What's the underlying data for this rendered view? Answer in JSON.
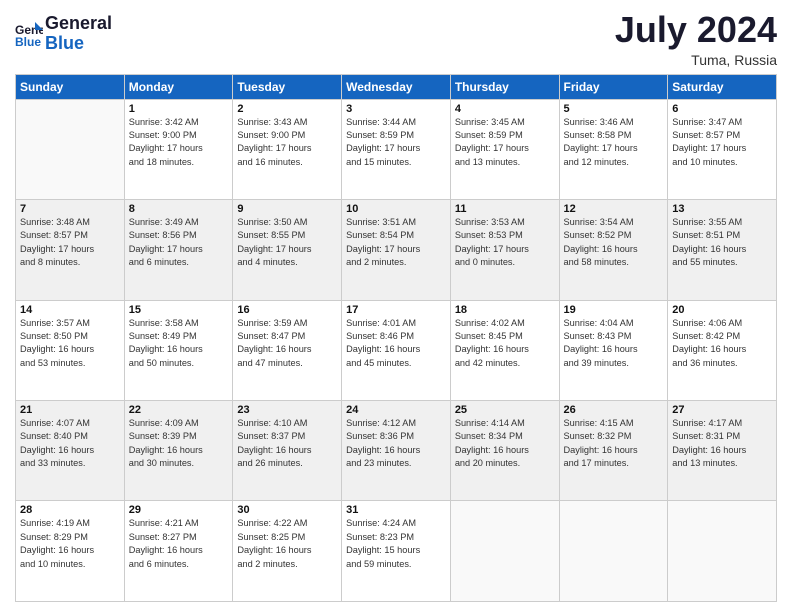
{
  "header": {
    "logo_line1": "General",
    "logo_line2": "Blue",
    "month_year": "July 2024",
    "location": "Tuma, Russia"
  },
  "days_of_week": [
    "Sunday",
    "Monday",
    "Tuesday",
    "Wednesday",
    "Thursday",
    "Friday",
    "Saturday"
  ],
  "weeks": [
    [
      {
        "day": "",
        "info": ""
      },
      {
        "day": "1",
        "info": "Sunrise: 3:42 AM\nSunset: 9:00 PM\nDaylight: 17 hours\nand 18 minutes."
      },
      {
        "day": "2",
        "info": "Sunrise: 3:43 AM\nSunset: 9:00 PM\nDaylight: 17 hours\nand 16 minutes."
      },
      {
        "day": "3",
        "info": "Sunrise: 3:44 AM\nSunset: 8:59 PM\nDaylight: 17 hours\nand 15 minutes."
      },
      {
        "day": "4",
        "info": "Sunrise: 3:45 AM\nSunset: 8:59 PM\nDaylight: 17 hours\nand 13 minutes."
      },
      {
        "day": "5",
        "info": "Sunrise: 3:46 AM\nSunset: 8:58 PM\nDaylight: 17 hours\nand 12 minutes."
      },
      {
        "day": "6",
        "info": "Sunrise: 3:47 AM\nSunset: 8:57 PM\nDaylight: 17 hours\nand 10 minutes."
      }
    ],
    [
      {
        "day": "7",
        "info": "Sunrise: 3:48 AM\nSunset: 8:57 PM\nDaylight: 17 hours\nand 8 minutes."
      },
      {
        "day": "8",
        "info": "Sunrise: 3:49 AM\nSunset: 8:56 PM\nDaylight: 17 hours\nand 6 minutes."
      },
      {
        "day": "9",
        "info": "Sunrise: 3:50 AM\nSunset: 8:55 PM\nDaylight: 17 hours\nand 4 minutes."
      },
      {
        "day": "10",
        "info": "Sunrise: 3:51 AM\nSunset: 8:54 PM\nDaylight: 17 hours\nand 2 minutes."
      },
      {
        "day": "11",
        "info": "Sunrise: 3:53 AM\nSunset: 8:53 PM\nDaylight: 17 hours\nand 0 minutes."
      },
      {
        "day": "12",
        "info": "Sunrise: 3:54 AM\nSunset: 8:52 PM\nDaylight: 16 hours\nand 58 minutes."
      },
      {
        "day": "13",
        "info": "Sunrise: 3:55 AM\nSunset: 8:51 PM\nDaylight: 16 hours\nand 55 minutes."
      }
    ],
    [
      {
        "day": "14",
        "info": "Sunrise: 3:57 AM\nSunset: 8:50 PM\nDaylight: 16 hours\nand 53 minutes."
      },
      {
        "day": "15",
        "info": "Sunrise: 3:58 AM\nSunset: 8:49 PM\nDaylight: 16 hours\nand 50 minutes."
      },
      {
        "day": "16",
        "info": "Sunrise: 3:59 AM\nSunset: 8:47 PM\nDaylight: 16 hours\nand 47 minutes."
      },
      {
        "day": "17",
        "info": "Sunrise: 4:01 AM\nSunset: 8:46 PM\nDaylight: 16 hours\nand 45 minutes."
      },
      {
        "day": "18",
        "info": "Sunrise: 4:02 AM\nSunset: 8:45 PM\nDaylight: 16 hours\nand 42 minutes."
      },
      {
        "day": "19",
        "info": "Sunrise: 4:04 AM\nSunset: 8:43 PM\nDaylight: 16 hours\nand 39 minutes."
      },
      {
        "day": "20",
        "info": "Sunrise: 4:06 AM\nSunset: 8:42 PM\nDaylight: 16 hours\nand 36 minutes."
      }
    ],
    [
      {
        "day": "21",
        "info": "Sunrise: 4:07 AM\nSunset: 8:40 PM\nDaylight: 16 hours\nand 33 minutes."
      },
      {
        "day": "22",
        "info": "Sunrise: 4:09 AM\nSunset: 8:39 PM\nDaylight: 16 hours\nand 30 minutes."
      },
      {
        "day": "23",
        "info": "Sunrise: 4:10 AM\nSunset: 8:37 PM\nDaylight: 16 hours\nand 26 minutes."
      },
      {
        "day": "24",
        "info": "Sunrise: 4:12 AM\nSunset: 8:36 PM\nDaylight: 16 hours\nand 23 minutes."
      },
      {
        "day": "25",
        "info": "Sunrise: 4:14 AM\nSunset: 8:34 PM\nDaylight: 16 hours\nand 20 minutes."
      },
      {
        "day": "26",
        "info": "Sunrise: 4:15 AM\nSunset: 8:32 PM\nDaylight: 16 hours\nand 17 minutes."
      },
      {
        "day": "27",
        "info": "Sunrise: 4:17 AM\nSunset: 8:31 PM\nDaylight: 16 hours\nand 13 minutes."
      }
    ],
    [
      {
        "day": "28",
        "info": "Sunrise: 4:19 AM\nSunset: 8:29 PM\nDaylight: 16 hours\nand 10 minutes."
      },
      {
        "day": "29",
        "info": "Sunrise: 4:21 AM\nSunset: 8:27 PM\nDaylight: 16 hours\nand 6 minutes."
      },
      {
        "day": "30",
        "info": "Sunrise: 4:22 AM\nSunset: 8:25 PM\nDaylight: 16 hours\nand 2 minutes."
      },
      {
        "day": "31",
        "info": "Sunrise: 4:24 AM\nSunset: 8:23 PM\nDaylight: 15 hours\nand 59 minutes."
      },
      {
        "day": "",
        "info": ""
      },
      {
        "day": "",
        "info": ""
      },
      {
        "day": "",
        "info": ""
      }
    ]
  ]
}
